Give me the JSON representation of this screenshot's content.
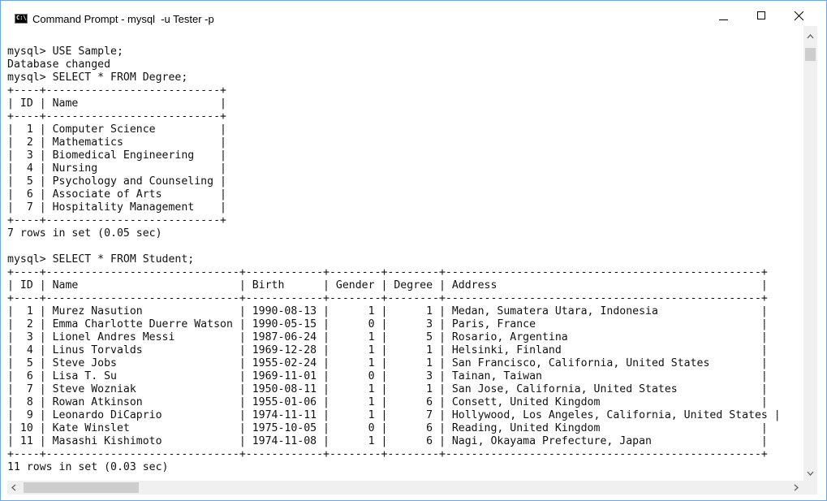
{
  "window": {
    "title": "Command Prompt - mysql  -u Tester -p",
    "icon": "C:\\"
  },
  "controls": [
    "minimize-icon",
    "maximize-icon",
    "close-icon"
  ],
  "console": {
    "text": "mysql> USE Sample;\nDatabase changed\nmysql> SELECT * FROM Degree;\n+----+---------------------------+\n| ID | Name                      |\n+----+---------------------------+\n|  1 | Computer Science          |\n|  2 | Mathematics               |\n|  3 | Biomedical Engineering    |\n|  4 | Nursing                   |\n|  5 | Psychology and Counseling |\n|  6 | Associate of Arts         |\n|  7 | Hospitality Management    |\n+----+---------------------------+\n7 rows in set (0.05 sec)\n\nmysql> SELECT * FROM Student;\n+----+------------------------------+------------+--------+--------+-------------------------------------------------+\n| ID | Name                         | Birth      | Gender | Degree | Address                                         |\n+----+------------------------------+------------+--------+--------+-------------------------------------------------+\n|  1 | Murez Nasution               | 1990-08-13 |      1 |      1 | Medan, Sumatera Utara, Indonesia                |\n|  2 | Emma Charlotte Duerre Watson | 1990-05-15 |      0 |      3 | Paris, France                                   |\n|  3 | Lionel Andres Messi          | 1987-06-24 |      1 |      5 | Rosario, Argentina                              |\n|  4 | Linus Torvalds               | 1969-12-28 |      1 |      1 | Helsinki, Finland                               |\n|  5 | Steve Jobs                   | 1955-02-24 |      1 |      1 | San Francisco, California, United States        |\n|  6 | Lisa T. Su                   | 1969-11-01 |      0 |      3 | Tainan, Taiwan                                  |\n|  7 | Steve Wozniak                | 1950-08-11 |      1 |      1 | San Jose, California, United States             |\n|  8 | Rowan Atkinson               | 1955-01-06 |      1 |      6 | Consett, United Kingdom                         |\n|  9 | Leonardo DiCaprio            | 1974-11-11 |      1 |      7 | Hollywood, Los Angeles, California, United States |\n| 10 | Kate Winslet                 | 1975-10-05 |      0 |      6 | Reading, United Kingdom                         |\n| 11 | Masashi Kishimoto            | 1974-11-08 |      1 |      6 | Nagi, Okayama Prefecture, Japan                 |\n+----+------------------------------+------------+--------+--------+-------------------------------------------------+\n11 rows in set (0.03 sec)"
  }
}
